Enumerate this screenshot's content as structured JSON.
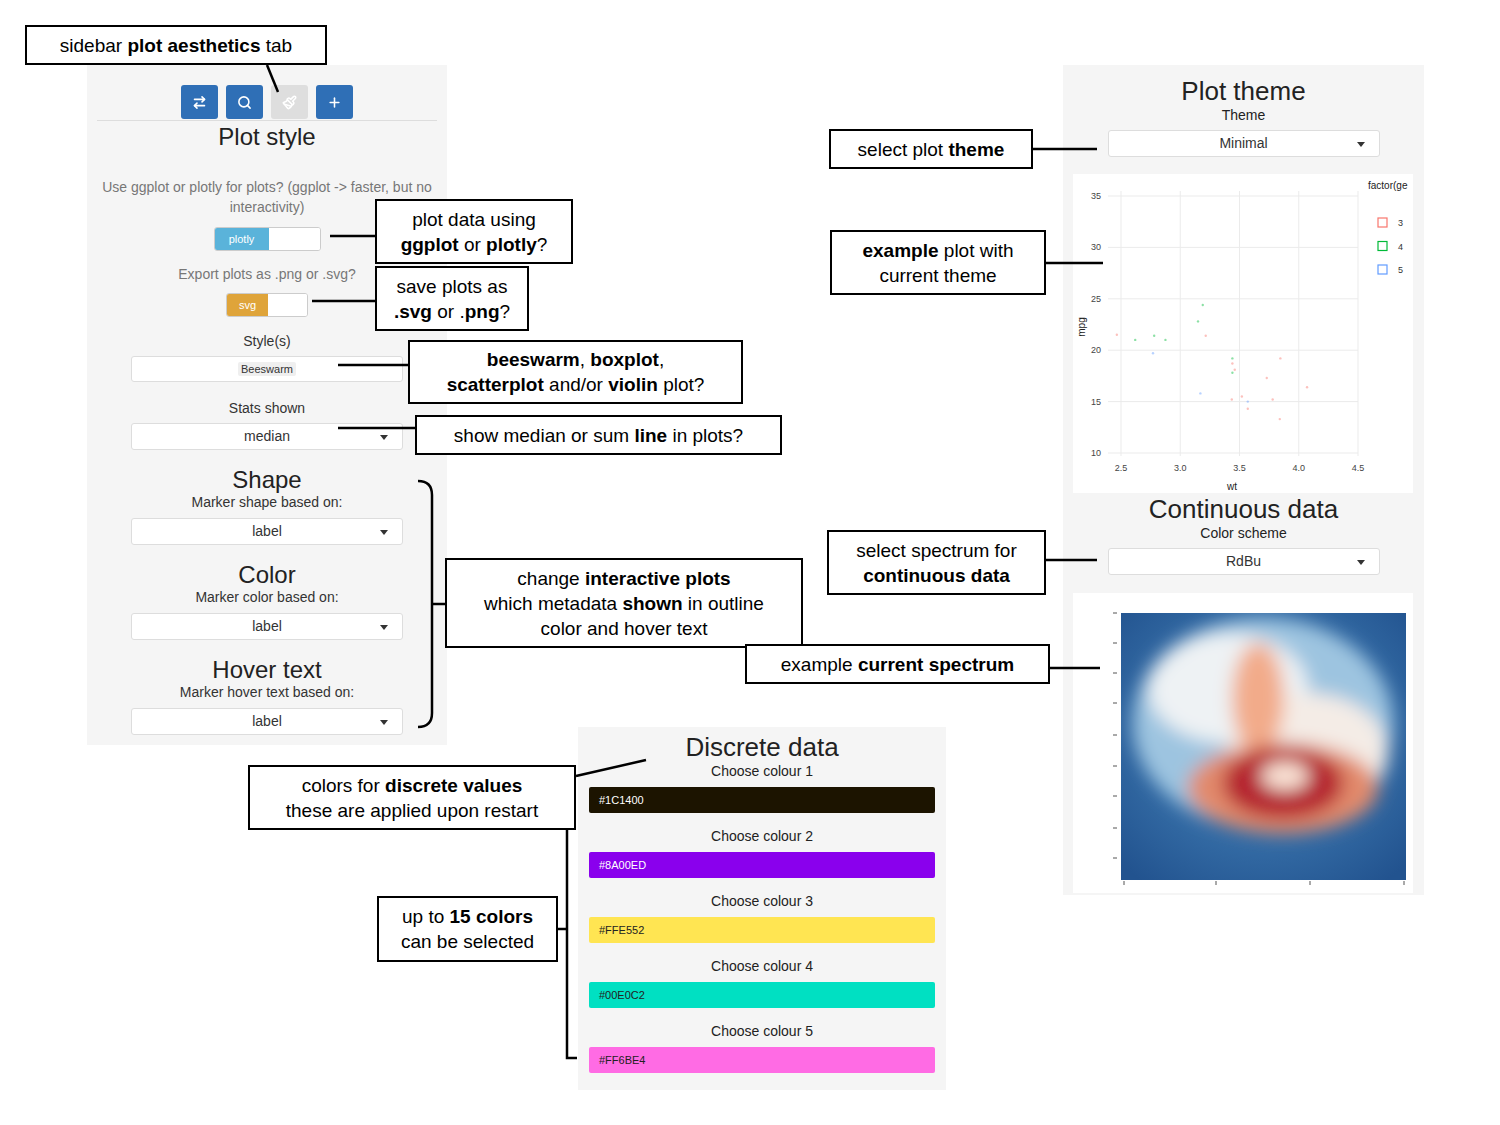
{
  "sidebar": {
    "tabs": [
      {
        "selected": false
      },
      {
        "selected": false
      },
      {
        "selected": true
      },
      {
        "selected": false
      }
    ],
    "title": "Plot style",
    "engine": {
      "question": "Use ggplot or plotly for plots? (ggplot -> faster, but no interactivity)",
      "label": "plotly",
      "on": true
    },
    "export": {
      "question": "Export plots as .png or .svg?",
      "label": "svg",
      "on": true
    },
    "styles": {
      "label": "Style(s)",
      "chips": [
        "Beeswarm"
      ]
    },
    "stats": {
      "label": "Stats shown",
      "value": "median"
    },
    "sections": [
      {
        "title": "Shape",
        "label": "Marker shape based on:",
        "value": "label"
      },
      {
        "title": "Color",
        "label": "Marker color based on:",
        "value": "label"
      },
      {
        "title": "Hover text",
        "label": "Marker hover text based on:",
        "value": "label"
      }
    ]
  },
  "theme_panel": {
    "title": "Plot theme",
    "label": "Theme",
    "value": "Minimal",
    "chart": {
      "legend_title": "factor(ge",
      "x_label": "wt",
      "y_label": "mpg",
      "x_ticks": [
        "2.5",
        "3.0",
        "3.5",
        "4.0",
        "4.5"
      ],
      "y_ticks": [
        "35",
        "30",
        "25",
        "20",
        "15",
        "10"
      ],
      "series": [
        {
          "name": "3",
          "color": "#F8766D",
          "points": [
            [
              3.215,
              21.4
            ],
            [
              3.44,
              18.7
            ],
            [
              3.46,
              18.1
            ],
            [
              3.57,
              14.3
            ],
            [
              4.07,
              16.4
            ],
            [
              3.73,
              17.3
            ],
            [
              3.78,
              15.2
            ],
            [
              3.52,
              15.5
            ],
            [
              3.435,
              15.2
            ],
            [
              3.84,
              13.3
            ],
            [
              3.845,
              19.2
            ],
            [
              2.465,
              21.5
            ]
          ]
        },
        {
          "name": "4",
          "color": "#00BA38",
          "points": [
            [
              2.62,
              21.0
            ],
            [
              2.875,
              21.0
            ],
            [
              3.19,
              24.4
            ],
            [
              3.15,
              22.8
            ],
            [
              3.44,
              19.2
            ],
            [
              3.44,
              17.8
            ],
            [
              2.78,
              21.4
            ]
          ]
        },
        {
          "name": "5",
          "color": "#619CFF",
          "points": [
            [
              3.17,
              15.8
            ],
            [
              2.77,
              19.7
            ],
            [
              3.57,
              15.0
            ]
          ]
        }
      ]
    },
    "continuous": {
      "title": "Continuous data",
      "label": "Color scheme",
      "value": "RdBu"
    }
  },
  "discrete": {
    "title": "Discrete data",
    "colours": [
      {
        "label": "Choose colour 1",
        "value": "#1C1400",
        "color": "#1C1400"
      },
      {
        "label": "Choose colour 2",
        "value": "#8A00ED",
        "color": "#8A00ED"
      },
      {
        "label": "Choose colour 3",
        "value": "#FFE552",
        "color": "#FFE552"
      },
      {
        "label": "Choose colour 4",
        "value": "#00E0C2",
        "color": "#00E0C2"
      },
      {
        "label": "Choose colour 5",
        "value": "#FF6BE4",
        "color": "#FF6BE4"
      }
    ]
  },
  "callouts": [
    {
      "lines": [
        [
          {
            "text": "sidebar ",
            "bold": false
          },
          {
            "text": "plot aesthetics",
            "bold": true
          },
          {
            "text": " tab",
            "bold": false
          }
        ]
      ]
    },
    {
      "lines": [
        [
          {
            "text": "plot data using",
            "bold": false
          }
        ],
        [
          {
            "text": "ggplot",
            "bold": true
          },
          {
            "text": " or ",
            "bold": false
          },
          {
            "text": "plotly",
            "bold": true
          },
          {
            "text": "?",
            "bold": false
          }
        ]
      ]
    },
    {
      "lines": [
        [
          {
            "text": "save plots as",
            "bold": false
          }
        ],
        [
          {
            "text": ".svg",
            "bold": true
          },
          {
            "text": " or .",
            "bold": false
          },
          {
            "text": "png",
            "bold": true
          },
          {
            "text": "?",
            "bold": false
          }
        ]
      ]
    },
    {
      "lines": [
        [
          {
            "text": "beeswarm",
            "bold": true
          },
          {
            "text": ", ",
            "bold": false
          },
          {
            "text": "boxplot",
            "bold": true
          },
          {
            "text": ",",
            "bold": false
          }
        ],
        [
          {
            "text": "scatterplot",
            "bold": true
          },
          {
            "text": " and/or ",
            "bold": false
          },
          {
            "text": "violin",
            "bold": true
          },
          {
            "text": " plot?",
            "bold": false
          }
        ]
      ]
    },
    {
      "lines": [
        [
          {
            "text": "show median or sum ",
            "bold": false
          },
          {
            "text": "line",
            "bold": true
          },
          {
            "text": " in plots?",
            "bold": false
          }
        ]
      ]
    },
    {
      "lines": [
        [
          {
            "text": "change ",
            "bold": false
          },
          {
            "text": "interactive plots",
            "bold": true
          }
        ],
        [
          {
            "text": "which metadata ",
            "bold": false
          },
          {
            "text": "shown",
            "bold": true
          },
          {
            "text": " in outline",
            "bold": false
          }
        ],
        [
          {
            "text": "color and hover text",
            "bold": false
          }
        ]
      ]
    },
    {
      "lines": [
        [
          {
            "text": "select plot ",
            "bold": false
          },
          {
            "text": "theme",
            "bold": true
          }
        ]
      ]
    },
    {
      "lines": [
        [
          {
            "text": "example",
            "bold": true
          },
          {
            "text": " plot with",
            "bold": false
          }
        ],
        [
          {
            "text": "current theme",
            "bold": false
          }
        ]
      ]
    },
    {
      "lines": [
        [
          {
            "text": "select spectrum for",
            "bold": false
          }
        ],
        [
          {
            "text": "continuous data",
            "bold": true
          }
        ]
      ]
    },
    {
      "lines": [
        [
          {
            "text": "example ",
            "bold": false
          },
          {
            "text": "current spectrum",
            "bold": true
          }
        ]
      ]
    },
    {
      "lines": [
        [
          {
            "text": "colors for ",
            "bold": false
          },
          {
            "text": "discrete values",
            "bold": true
          }
        ],
        [
          {
            "text": "these are applied upon restart",
            "bold": false
          }
        ]
      ]
    },
    {
      "lines": [
        [
          {
            "text": "up to ",
            "bold": false
          },
          {
            "text": "15 colors",
            "bold": true
          }
        ],
        [
          {
            "text": "can be selected",
            "bold": false
          }
        ]
      ]
    }
  ]
}
